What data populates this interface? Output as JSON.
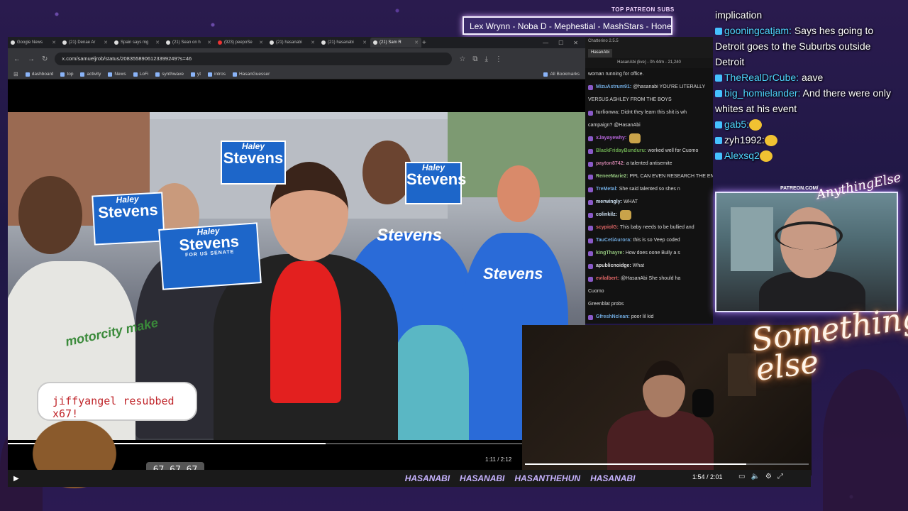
{
  "patreon": {
    "label": "TOP PATREON SUBS",
    "names": "Lex Wrynn  -  Noba D  -  Mephestial  -  MashStars  -  Honestl"
  },
  "browser": {
    "tabs": [
      {
        "label": "Google News",
        "icon": "google-icon"
      },
      {
        "label": "(21) Denae Ar",
        "icon": "x-icon"
      },
      {
        "label": "Spain says mg",
        "icon": "x-icon"
      },
      {
        "label": "(21) Sean on h",
        "icon": "x-icon"
      },
      {
        "label": "(923) peepoSe",
        "icon": "youtube-icon"
      },
      {
        "label": "(21) hasanabi",
        "icon": "x-icon"
      },
      {
        "label": "(21) hasanabi",
        "icon": "x-icon"
      },
      {
        "label": "(21) Sam R",
        "icon": "x-icon"
      }
    ],
    "url": "x.com/samueljrob/status/2083558906123399249?s=46",
    "bookmarks": [
      "dashboard",
      "top",
      "activity",
      "News",
      "LoFi",
      "synthwave",
      "yt",
      "intros",
      "HasanGuesser"
    ],
    "all_bookmarks": "All Bookmarks",
    "video_time": "1:11 / 2:12"
  },
  "video": {
    "sign_line1": "Haley",
    "sign_line2": "Stevens",
    "sign_line3": "FOR US SENATE",
    "shirt_text": "Stevens",
    "motor_text": "motorcity make"
  },
  "alert": {
    "user": "jiffyangel",
    "text": "resubbed x67!",
    "count": "67 67 67"
  },
  "chatterino": {
    "title": "Chatterino 2.5.5",
    "tab": "HasanAbi",
    "header": "HasanAbi (live) - 0h 44m - 21,240",
    "messages": [
      {
        "user": "",
        "text": "woman running for office.",
        "color": "#ddd"
      },
      {
        "user": "MizuAstrum91:",
        "text": "@hasanabi YOU'RE LITERALLY",
        "color": "#6fa8dc"
      },
      {
        "user": "",
        "text": "VERSUS ASHLEY FROM THE BOYS",
        "color": "#ddd"
      },
      {
        "user": "turlionwa:",
        "text": "Didnt they learn this shit is wh",
        "color": "#aaa"
      },
      {
        "user": "",
        "text": "campaign? @HasanAbi",
        "color": "#ddd"
      },
      {
        "user": "xJayayewhy:",
        "text": "",
        "color": "#b565d9"
      },
      {
        "user": "BlackFridayBunduru:",
        "text": "worked well for Cuomo",
        "color": "#6aa84f"
      },
      {
        "user": "payton8742:",
        "text": "a talented antisemite",
        "color": "#c27ba0"
      },
      {
        "user": "ReneeMarie2:",
        "text": "PPL CAN EVEN RESEARCH THE ENEMY LMAOOOO",
        "color": "#93c47d"
      },
      {
        "user": "TreMetal:",
        "text": "She said talented so shes n",
        "color": "#6fa8dc"
      },
      {
        "user": "merwingly:",
        "text": "WHAT",
        "color": "#cfe2f3"
      },
      {
        "user": "colinkilz:",
        "text": "",
        "color": "#cfe2f3"
      },
      {
        "user": "scypiolG:",
        "text": "This baby needs to be bullied and",
        "color": "#e06666"
      },
      {
        "user": "TauCetiAurora:",
        "text": "this is so Veep coded",
        "color": "#6fa8dc"
      },
      {
        "user": "kingThayre:",
        "text": "How does oone Bully a s",
        "color": "#93c47d"
      },
      {
        "user": "apublicnoidge:",
        "text": "What",
        "color": "#ddd"
      },
      {
        "user": "evilalbert:",
        "text": "@HasanAbi She should ha",
        "color": "#e06666"
      },
      {
        "user": "",
        "text": "Cuomo",
        "color": "#ddd"
      },
      {
        "user": "",
        "text": "Greenblat probs",
        "color": "#ddd"
      },
      {
        "user": "GfreshNclean:",
        "text": "poor lil kid",
        "color": "#6fa8dc"
      }
    ]
  },
  "bigchat": [
    {
      "user": "",
      "text": "implication"
    },
    {
      "user": "gooningcatjam:",
      "text": " Says hes going to Detroit goes to the Suburbs outside Detroit",
      "color": "#4fd6ff"
    },
    {
      "user": "TheRealDrCube:",
      "text": " aave",
      "color": "#4fd6ff"
    },
    {
      "user": "big_homielander:",
      "text": " And there were only whites at his event",
      "color": "#4fd6ff"
    },
    {
      "user": "gab5:",
      "text": "",
      "color": "#4fd6ff"
    },
    {
      "user": "zyh1992:",
      "text": "",
      "color": "#fff"
    },
    {
      "user": "Alexsq2",
      "text": "",
      "color": "#4fd6ff"
    }
  ],
  "overlay": {
    "patreon_url": "PATREON.COM/",
    "anything_else": "AnythingElse",
    "something_else": "Something else"
  },
  "bottom": {
    "ticker": [
      "HASANABI",
      "HASANABI",
      "HASANTHEHUN",
      "HASANABI"
    ],
    "time": "1:54 / 2:01"
  }
}
